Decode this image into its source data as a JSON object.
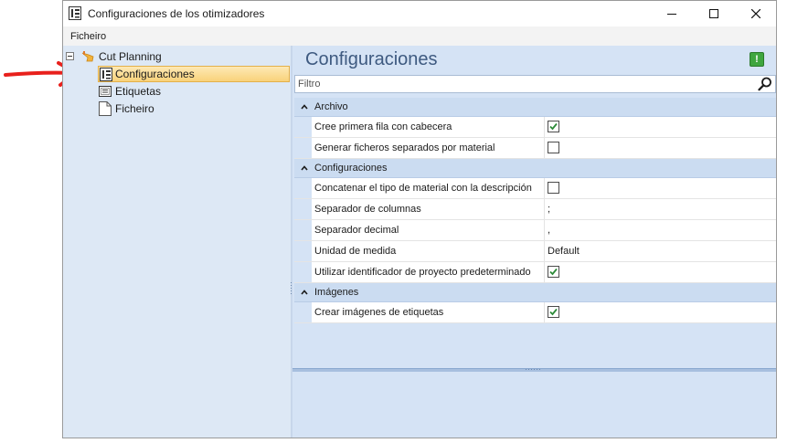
{
  "window": {
    "title": "Configuraciones de los otimizadores",
    "menu": [
      "Ficheiro"
    ]
  },
  "tree": {
    "root": {
      "label": "Cut Planning",
      "icon": "hand-pointer-icon"
    },
    "items": [
      {
        "label": "Configuraciones",
        "icon": "settings-document-icon",
        "selected": true
      },
      {
        "label": "Etiquetas",
        "icon": "label-icon",
        "selected": false
      },
      {
        "label": "Ficheiro",
        "icon": "file-icon",
        "selected": false
      }
    ]
  },
  "panel": {
    "title": "Configuraciones",
    "filter_placeholder": "Filtro"
  },
  "grid": {
    "categories": [
      {
        "label": "Archivo",
        "rows": [
          {
            "name": "Cree primera fila con cabecera",
            "type": "checkbox",
            "checked": true
          },
          {
            "name": "Generar ficheros separados por material",
            "type": "checkbox",
            "checked": false
          }
        ]
      },
      {
        "label": "Configuraciones",
        "rows": [
          {
            "name": "Concatenar el tipo de material con la descripción",
            "type": "checkbox",
            "checked": false
          },
          {
            "name": "Separador de columnas",
            "type": "text",
            "value": ";"
          },
          {
            "name": "Separador decimal",
            "type": "text",
            "value": ","
          },
          {
            "name": "Unidad de medida",
            "type": "text",
            "value": "Default"
          },
          {
            "name": "Utilizar identificador de proyecto predeterminado",
            "type": "checkbox",
            "checked": true
          }
        ]
      },
      {
        "label": "Imágenes",
        "rows": [
          {
            "name": "Crear imágenes de etiquetas",
            "type": "checkbox",
            "checked": true
          }
        ]
      }
    ]
  },
  "colors": {
    "annotation_arrow": "#e8201c",
    "selection": "#f9d27a",
    "pane_background": "#d5e3f5",
    "check_green": "#2e8b3a"
  }
}
